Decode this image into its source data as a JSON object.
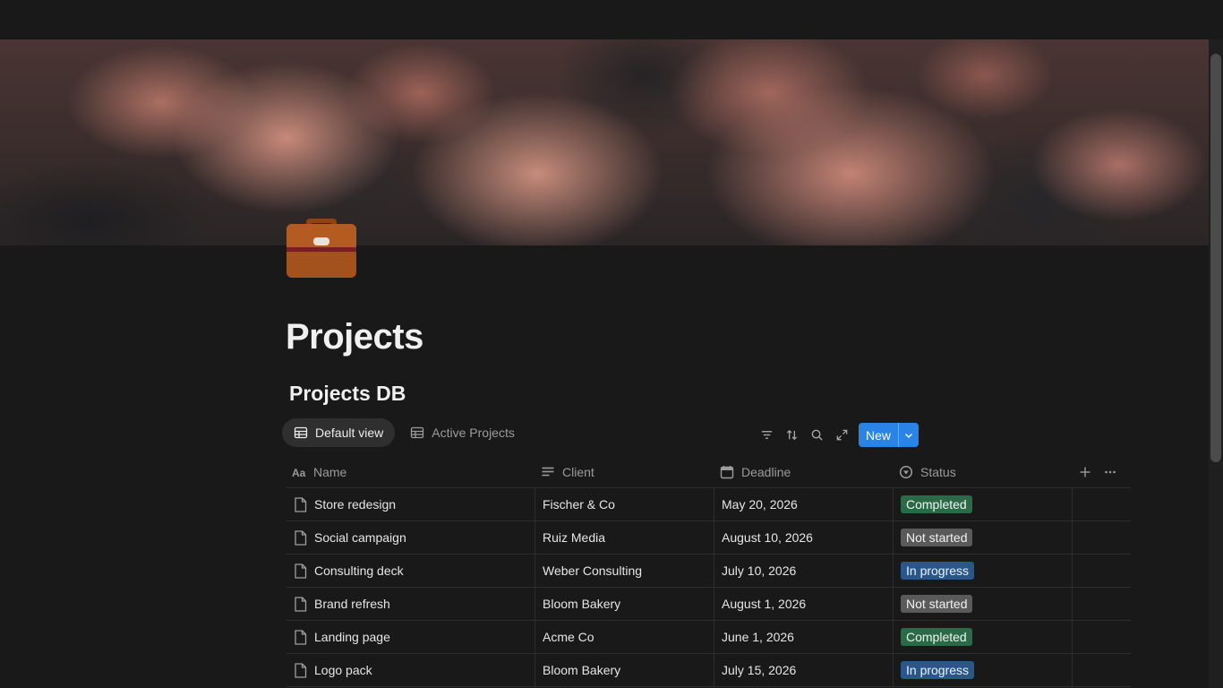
{
  "page": {
    "title": "Projects"
  },
  "database": {
    "title": "Projects DB"
  },
  "views": [
    {
      "label": "Default view",
      "active": true
    },
    {
      "label": "Active Projects",
      "active": false
    }
  ],
  "toolbar": {
    "icons": [
      "filter-icon",
      "sort-icon",
      "search-icon",
      "expand-icon"
    ],
    "new_label": "New"
  },
  "columns": [
    {
      "label": "Name",
      "icon": "text-type-icon"
    },
    {
      "label": "Client",
      "icon": "text-lines-icon"
    },
    {
      "label": "Deadline",
      "icon": "calendar-icon"
    },
    {
      "label": "Status",
      "icon": "status-icon"
    }
  ],
  "rows": [
    {
      "name": "Store redesign",
      "client": "Fischer & Co",
      "deadline": "May 20, 2026",
      "status": "Completed"
    },
    {
      "name": "Social campaign",
      "client": "Ruiz Media",
      "deadline": "August 10, 2026",
      "status": "Not started"
    },
    {
      "name": "Consulting deck",
      "client": "Weber Consulting",
      "deadline": "July 10, 2026",
      "status": "In progress"
    },
    {
      "name": "Brand refresh",
      "client": "Bloom Bakery",
      "deadline": "August 1, 2026",
      "status": "Not started"
    },
    {
      "name": "Landing page",
      "client": "Acme Co",
      "deadline": "June 1, 2026",
      "status": "Completed"
    },
    {
      "name": "Logo pack",
      "client": "Bloom Bakery",
      "deadline": "July 15, 2026",
      "status": "In progress"
    }
  ],
  "status_colors": {
    "Completed": "#2b6a46",
    "Not started": "#5a5a5a",
    "In progress": "#28578c"
  },
  "accent": "#2a84e6"
}
